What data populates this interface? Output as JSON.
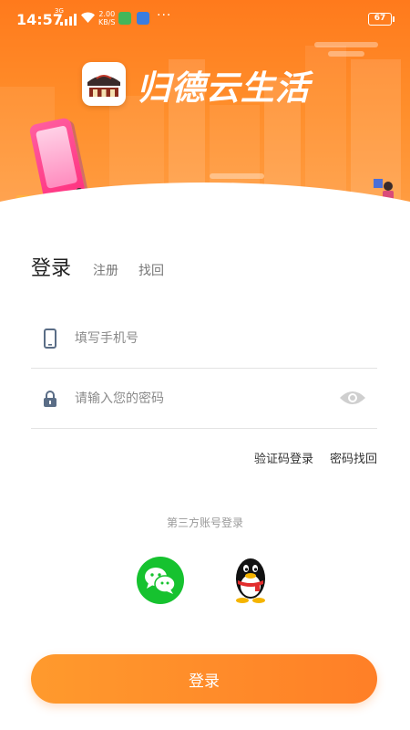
{
  "status_bar": {
    "time": "14:57",
    "network_generation": "3G",
    "net_speed_value": "2.00",
    "net_speed_unit": "KB/S",
    "more_indicator": "···",
    "battery_level": "67"
  },
  "header": {
    "app_title": "归德云生活",
    "logo_icon": "ancient-gate-logo",
    "background_color": "#ff8a2a"
  },
  "tabs": [
    {
      "label": "登录",
      "active": true
    },
    {
      "label": "注册",
      "active": false
    },
    {
      "label": "找回",
      "active": false
    }
  ],
  "form": {
    "phone_placeholder": "填写手机号",
    "phone_icon": "phone-icon",
    "password_placeholder": "请输入您的密码",
    "password_icon": "lock-icon",
    "visibility_icon": "eye-icon"
  },
  "links": {
    "sms_login": "验证码登录",
    "recover_password": "密码找回"
  },
  "third_party": {
    "label": "第三方账号登录",
    "providers": [
      "wechat-icon",
      "qq-icon"
    ]
  },
  "login_button": {
    "label": "登录",
    "color": "#ff8c2a"
  }
}
